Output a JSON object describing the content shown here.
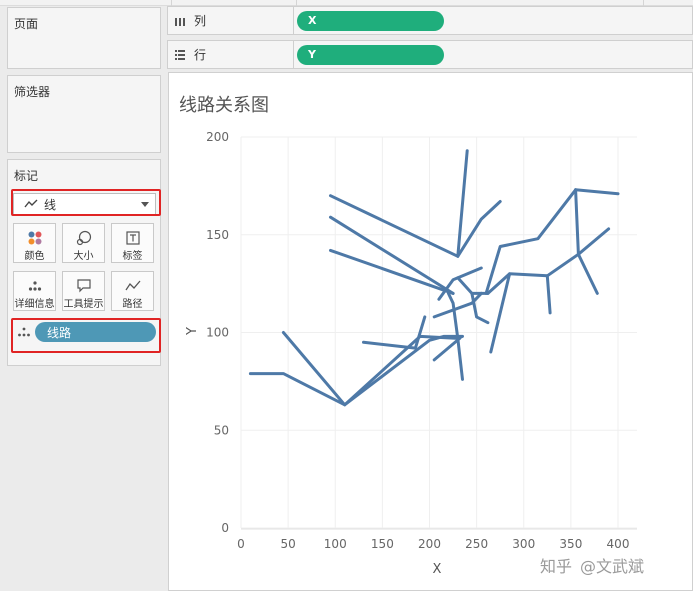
{
  "panels": {
    "pages": "页面",
    "filters": "筛选器",
    "marks": "标记"
  },
  "marks": {
    "type": "线",
    "cards": [
      "颜色",
      "大小",
      "标签",
      "详细信息",
      "工具提示",
      "路径"
    ],
    "detail_pill": "线路"
  },
  "shelves": {
    "columns_label": "列",
    "columns_field": "X",
    "rows_label": "行",
    "rows_field": "Y"
  },
  "watermark": {
    "brand": "知乎",
    "author": "@文武斌"
  },
  "colors": {
    "line": "#4e79a7",
    "pill_green": "#1fae7c",
    "pill_blue": "#4e98b6",
    "highlight": "#e02424"
  },
  "chart_data": {
    "type": "line",
    "title": "线路关系图",
    "xlabel": "X",
    "ylabel": "Y",
    "xlim": [
      0,
      420
    ],
    "ylim": [
      0,
      200
    ],
    "xticks": [
      0,
      50,
      100,
      150,
      200,
      250,
      300,
      350,
      400
    ],
    "yticks": [
      0,
      50,
      100,
      150,
      200
    ],
    "grid": true,
    "paths": [
      [
        [
          10,
          79
        ],
        [
          45,
          79
        ],
        [
          110,
          63
        ],
        [
          200,
          96
        ],
        [
          215,
          98
        ],
        [
          235,
          98
        ],
        [
          230,
          97
        ],
        [
          225,
          115
        ],
        [
          220,
          120
        ]
      ],
      [
        [
          45,
          100
        ],
        [
          110,
          63
        ],
        [
          190,
          98
        ],
        [
          230,
          97
        ],
        [
          235,
          76
        ]
      ],
      [
        [
          95,
          170
        ],
        [
          230,
          139
        ],
        [
          240,
          193
        ]
      ],
      [
        [
          95,
          159
        ],
        [
          225,
          120
        ]
      ],
      [
        [
          95,
          142
        ],
        [
          225,
          120
        ]
      ],
      [
        [
          130,
          95
        ],
        [
          185,
          92
        ],
        [
          195,
          108
        ]
      ],
      [
        [
          205,
          86
        ],
        [
          232,
          97
        ]
      ],
      [
        [
          205,
          108
        ],
        [
          245,
          115
        ],
        [
          255,
          120
        ]
      ],
      [
        [
          230,
          128
        ],
        [
          245,
          120
        ],
        [
          250,
          108
        ],
        [
          262,
          105
        ]
      ],
      [
        [
          210,
          117
        ],
        [
          225,
          127
        ],
        [
          255,
          133
        ]
      ],
      [
        [
          230,
          139
        ],
        [
          255,
          158
        ],
        [
          275,
          167
        ]
      ],
      [
        [
          262,
          120
        ],
        [
          245,
          120
        ]
      ],
      [
        [
          260,
          120
        ],
        [
          275,
          144
        ],
        [
          315,
          148
        ],
        [
          355,
          173
        ]
      ],
      [
        [
          355,
          173
        ],
        [
          400,
          171
        ]
      ],
      [
        [
          355,
          173
        ],
        [
          358,
          140
        ],
        [
          378,
          120
        ]
      ],
      [
        [
          358,
          140
        ],
        [
          390,
          153
        ]
      ],
      [
        [
          262,
          120
        ],
        [
          285,
          130
        ],
        [
          325,
          129
        ],
        [
          358,
          140
        ]
      ],
      [
        [
          265,
          90
        ],
        [
          285,
          130
        ]
      ],
      [
        [
          325,
          129
        ],
        [
          328,
          110
        ]
      ]
    ]
  }
}
